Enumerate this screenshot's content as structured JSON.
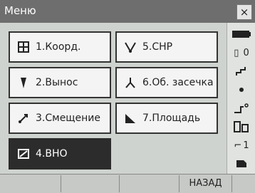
{
  "window": {
    "title": "Меню",
    "close_label": "×"
  },
  "menu": {
    "items": [
      {
        "label": "1.Коорд.",
        "icon": "coordinates-icon",
        "active": false
      },
      {
        "label": "2.Вынос",
        "icon": "stakeout-icon",
        "active": false
      },
      {
        "label": "3.Смещение",
        "icon": "offset-icon",
        "active": false
      },
      {
        "label": "4.ВНО",
        "icon": "remote-elevation-icon",
        "active": true
      },
      {
        "label": "5.СНР",
        "icon": "missing-line-icon",
        "active": false
      },
      {
        "label": "6.Об. засечка",
        "icon": "resection-icon",
        "active": false
      },
      {
        "label": "7.Площадь",
        "icon": "area-icon",
        "active": false
      }
    ]
  },
  "sidebar": {
    "items": [
      {
        "label": "",
        "icon": "battery-icon"
      },
      {
        "label": "0",
        "icon": "target-constant-icon"
      },
      {
        "label": "",
        "icon": "tilt-icon"
      },
      {
        "label": "",
        "icon": "signal-icon"
      },
      {
        "label": "",
        "icon": "laser-icon"
      },
      {
        "label": "",
        "icon": "prism-icon"
      },
      {
        "label": "1",
        "icon": "face-icon"
      },
      {
        "label": "",
        "icon": "keyboard-icon"
      }
    ]
  },
  "softkeys": {
    "labels": [
      "",
      "",
      "",
      "НАЗАД"
    ]
  }
}
